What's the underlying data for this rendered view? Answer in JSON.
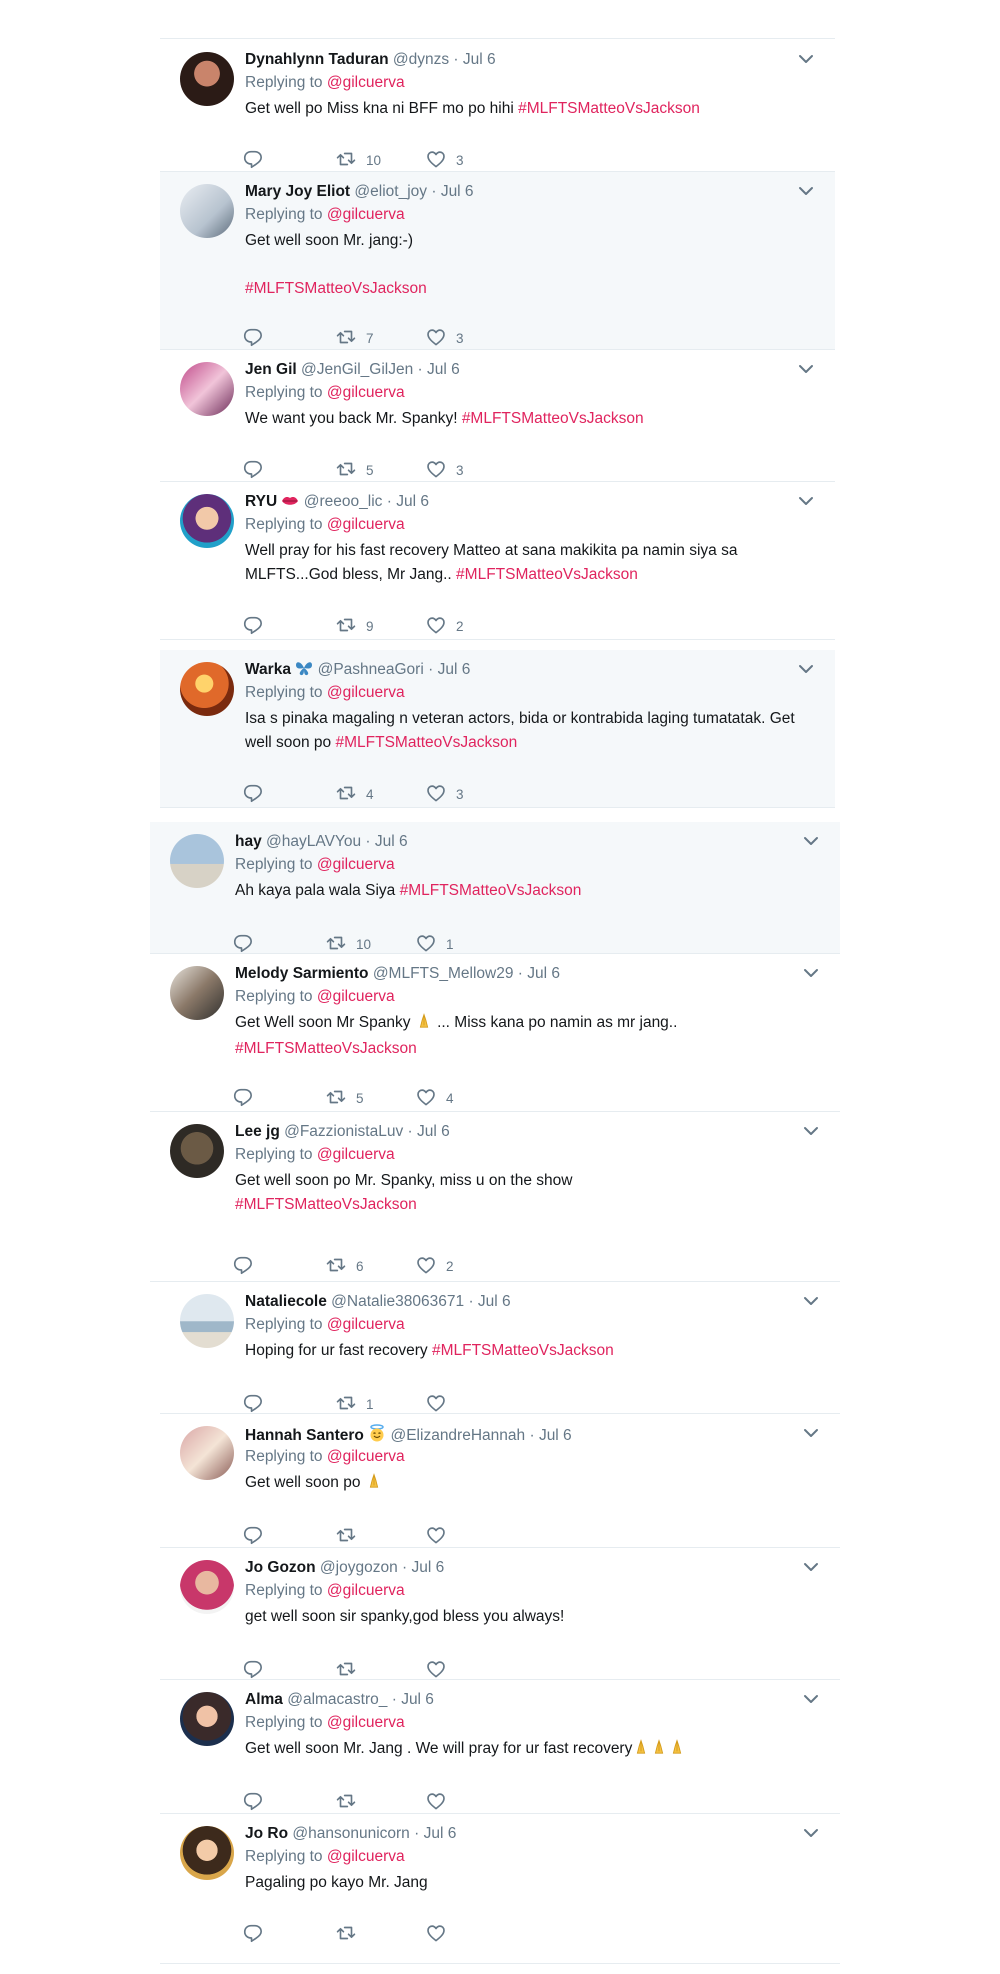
{
  "theme": {
    "hashtag": "#e0245e",
    "muted": "#657786",
    "highlight_bg": "#f5f8fa",
    "text": "#14171a"
  },
  "icons": {
    "reply": "reply-icon",
    "retweet": "retweet-icon",
    "like": "heart-icon",
    "more": "chevron-down-icon"
  },
  "replying_prefix": "Replying to",
  "replies": [
    {
      "name": "Dynahlynn Taduran",
      "handle": "@dynzs",
      "sep": "·",
      "time": "Jul 6",
      "to": "@gilcuerva",
      "text": "Get well po Miss kna ni BFF mo po hihi ",
      "hashtag": "#MLFTSMatteoVsJackson",
      "retweets": "10",
      "likes": "3"
    },
    {
      "name": "Mary Joy Eliot",
      "handle": "@eliot_joy",
      "sep": "·",
      "time": "Jul 6",
      "to": "@gilcuerva",
      "text": "Get well soon Mr. jang:-)",
      "hashtag": "#MLFTSMatteoVsJackson",
      "retweets": "7",
      "likes": "3"
    },
    {
      "name": "Jen Gil",
      "handle": "@JenGil_GilJen",
      "sep": "·",
      "time": "Jul 6",
      "to": "@gilcuerva",
      "text": "We want you back Mr. Spanky! ",
      "hashtag": "#MLFTSMatteoVsJackson",
      "retweets": "5",
      "likes": "3"
    },
    {
      "name": "RYU",
      "name_emoji": "lips-emoji",
      "handle": "@reeoo_lic",
      "sep": "·",
      "time": "Jul 6",
      "to": "@gilcuerva",
      "text": "Well pray for his fast recovery Matteo at sana makikita pa namin siya sa MLFTS...God bless, Mr Jang.. ",
      "hashtag": "#MLFTSMatteoVsJackson",
      "retweets": "9",
      "likes": "2"
    },
    {
      "name": "Warka",
      "name_emoji": "butterfly-emoji",
      "handle": "@PashneaGori",
      "sep": "·",
      "time": "Jul 6",
      "to": "@gilcuerva",
      "text": "Isa s pinaka magaling n veteran actors, bida or kontrabida laging tumatatak. Get well soon po ",
      "hashtag": "#MLFTSMatteoVsJackson",
      "retweets": "4",
      "likes": "3"
    },
    {
      "name": "hay",
      "handle": "@hayLAVYou",
      "sep": "·",
      "time": "Jul 6",
      "to": "@gilcuerva",
      "text": "Ah kaya pala wala Siya ",
      "hashtag": "#MLFTSMatteoVsJackson",
      "retweets": "10",
      "likes": "1"
    },
    {
      "name": "Melody Sarmiento",
      "handle": "@MLFTS_Mellow29",
      "sep": "·",
      "time": "Jul 6",
      "to": "@gilcuerva",
      "text": "Get Well soon Mr Spanky ",
      "text_after_emoji": " ... Miss kana po namin as mr jang..",
      "hashtag": "#MLFTSMatteoVsJackson",
      "retweets": "5",
      "likes": "4"
    },
    {
      "name": "Lee jg",
      "handle": "@FazzionistaLuv",
      "sep": "·",
      "time": "Jul 6",
      "to": "@gilcuerva",
      "text": "Get well soon po Mr. Spanky, miss u on the show",
      "hashtag": "#MLFTSMatteoVsJackson",
      "retweets": "6",
      "likes": "2"
    },
    {
      "name": "Nataliecole",
      "handle": "@Natalie38063671",
      "sep": "·",
      "time": "Jul 6",
      "to": "@gilcuerva",
      "text": "Hoping for ur fast recovery ",
      "hashtag": "#MLFTSMatteoVsJackson",
      "retweets": "1",
      "likes": ""
    },
    {
      "name": "Hannah Santero",
      "name_emoji": "smiling-face-with-halo-emoji",
      "handle": "@ElizandreHannah",
      "sep": "·",
      "time": "Jul 6",
      "to": "@gilcuerva",
      "text": "Get well soon po ",
      "retweets": "",
      "likes": ""
    },
    {
      "name": "Jo Gozon",
      "handle": "@joygozon",
      "sep": "·",
      "time": "Jul 6",
      "to": "@gilcuerva",
      "text": "get well soon sir spanky,god bless you always!",
      "retweets": "",
      "likes": ""
    },
    {
      "name": "Alma",
      "handle": "@almacastro_",
      "sep": "·",
      "time": "Jul 6",
      "to": "@gilcuerva",
      "text": "Get well soon Mr. Jang . We will pray for ur fast recovery",
      "retweets": "",
      "likes": ""
    },
    {
      "name": "Jo Ro",
      "handle": "@hansonunicorn",
      "sep": "·",
      "time": "Jul 6",
      "to": "@gilcuerva",
      "text": "Pagaling po kayo Mr. Jang",
      "retweets": "",
      "likes": ""
    }
  ]
}
